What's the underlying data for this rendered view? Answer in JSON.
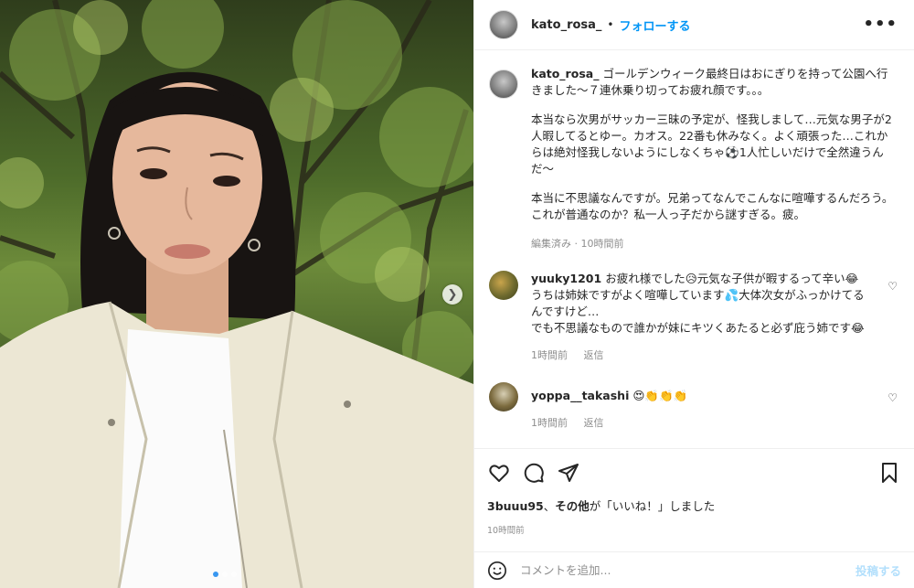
{
  "post": {
    "username": "kato_rosa_",
    "dot": "•",
    "follow_label": "フォローする",
    "more_label": "•••",
    "caption": {
      "username": "kato_rosa_",
      "lines": [
        "ゴールデンウィーク最終日はおにぎりを持って公園へ行きました〜７連休乗り切ってお疲れ顔です。。。",
        "本当なら次男がサッカー三昧の予定が、怪我しまして…元気な男子が2人暇してるとゆー。カオス。22番も休みなく。よく頑張った…これからは絶対怪我しないようにしなくちゃ⚽1人忙しいだけで全然違うんだ〜",
        "本当に不思議なんですが。兄弟ってなんでこんなに喧嘩するんだろう。これが普通なのか？私一人っ子だから謎すぎる。疲。"
      ],
      "meta": "編集済み · 10時間前"
    },
    "comments": [
      {
        "username": "yuuky1201",
        "text": "お疲れ様でした😥元気な子供が暇するって辛い😂うちは姉妹ですがよく喧嘩しています💦大体次女がふっかけてるんですけど…\nでも不思議なもので誰かが妹にキツくあたると必ず庇う姉です😂",
        "time": "1時間前",
        "reply": "返信"
      },
      {
        "username": "yoppa__takashi",
        "text": "😍👏👏👏",
        "time": "1時間前",
        "reply": "返信"
      }
    ],
    "likes": {
      "liker": "3buuu95",
      "rest_a": "、",
      "others": "その他",
      "rest_b": "が「いいね！」しました"
    },
    "timestamp": "10時間前",
    "add_comment": {
      "placeholder": "コメントを追加...",
      "post_label": "投稿する"
    }
  },
  "icons": [
    "chevron-right-icon",
    "heart-icon",
    "comment-icon",
    "share-icon",
    "bookmark-icon",
    "smile-icon"
  ],
  "colors": {
    "accent": "#0095f6",
    "post_disabled": "#b2dffc",
    "muted": "#8e8e8e"
  }
}
